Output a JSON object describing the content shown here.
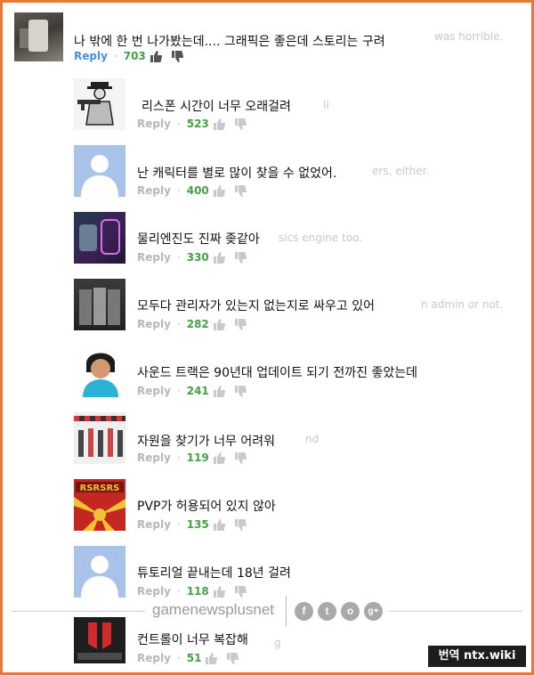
{
  "comments": [
    {
      "text": "나 밖에 한 번 나가봤는데.... 그래픽은 좋은데 스토리는 구려",
      "ghost": "was horrible.",
      "reply": "Reply",
      "likes": "703",
      "avatar": "game-screenshot-avatar"
    },
    {
      "text": "리스폰 시간이 너무 오래걸려",
      "ghost": "ll",
      "reply": "Reply",
      "likes": "523",
      "avatar": "gangster-sketch-avatar"
    },
    {
      "text": "난 캐릭터를 별로 많이 찾을 수 없었어.",
      "ghost": "ers, either.",
      "reply": "Reply",
      "likes": "400",
      "avatar": "default-person-avatar"
    },
    {
      "text": "물리엔진도 진짜 좆같아",
      "ghost": "sics engine too.",
      "reply": "Reply",
      "likes": "330",
      "avatar": "neon-characters-avatar"
    },
    {
      "text": "모두다 관리자가 있는지 없는지로 싸우고 있어",
      "ghost": "n admin or not.",
      "reply": "Reply",
      "likes": "282",
      "avatar": "soldiers-avatar"
    },
    {
      "text": "사운드 트랙은 90년대 업데이트 되기 전까진 좋았는데",
      "ghost": "",
      "reply": "Reply",
      "likes": "241",
      "avatar": "cartoon-girl-avatar"
    },
    {
      "text": "자원을 찾기가 너무 어려워",
      "ghost": "nd",
      "reply": "Reply",
      "likes": "119",
      "avatar": "dancers-avatar"
    },
    {
      "text": "PVP가 허용되어 있지 않아",
      "ghost": "",
      "reply": "Reply",
      "likes": "135",
      "avatar": "rsrsrs-flag-avatar"
    },
    {
      "text": "튜토리얼 끝내는데 18년 걸려",
      "ghost": "",
      "reply": "Reply",
      "likes": "118",
      "avatar": "default-person-avatar"
    },
    {
      "text": "컨트롤이 너무 복잡해",
      "ghost": "g",
      "reply": "Reply",
      "likes": "51",
      "avatar": "red-logo-avatar"
    }
  ],
  "watermark": {
    "site": "gamenewsplusnet",
    "social": [
      "f",
      "t",
      "o",
      "g+"
    ]
  },
  "badge": "번역 ntx.wiki",
  "colors": {
    "frame": "#e8793a",
    "likes": "#46a046",
    "reply_first": "#4a8fd6"
  }
}
